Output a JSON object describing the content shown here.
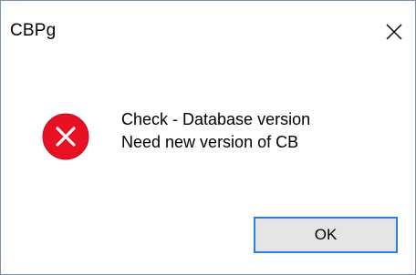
{
  "window": {
    "title": "CBPg"
  },
  "message": {
    "line1": "Check - Database version",
    "line2": "Need new version of CB"
  },
  "buttons": {
    "ok_label": "OK"
  },
  "icons": {
    "close": "close-icon",
    "error": "error-icon"
  },
  "colors": {
    "error_red": "#e81123",
    "button_border": "#2d7fd1",
    "button_bg": "#e5e5e5"
  }
}
